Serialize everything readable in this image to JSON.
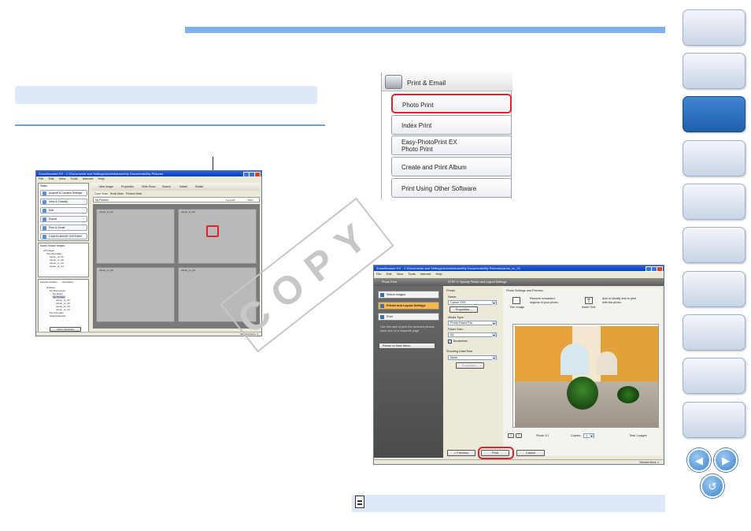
{
  "zoombrowser": {
    "title": "ZoomBrowser EX - C:\\Documents and Settings\\Administrator\\My Documents\\My Pictures",
    "menu": [
      "File",
      "Edit",
      "View",
      "Tools",
      "Internet",
      "Help"
    ],
    "tasks_label": "Tasks",
    "tasks": [
      "Acquire & Camera Settings",
      "View & Classify",
      "Edit",
      "Export",
      "Print & Email",
      "CANON iMAGE GATEWAY"
    ],
    "saved_search_label": "Saved Search Images",
    "saved_search_items": [
      "All Images",
      "Shooting Date",
      "canon_xx_01",
      "canon_xx_02",
      "canon_xx_03",
      "canon_xx_04"
    ],
    "folders_tabs": [
      "Favorite Folders",
      "All Folders"
    ],
    "folder_tree": [
      "Desktop",
      "My Documents",
      "My Music",
      "My Pictures",
      "canon_xx_01",
      "canon_xx_02",
      "canon_xx_03",
      "canon_xx_04",
      "My Computer",
      "Search Results"
    ],
    "add_favorites": "Add to Favorites",
    "toolbar": [
      "New Image",
      "Properties",
      "Slide Show",
      "Search",
      "Delete",
      "Rotate"
    ],
    "view_tabs": [
      "Zoom Mode",
      "Scroll Mode",
      "Preview Mode"
    ],
    "location": "My Pictures",
    "zoom_value": "Level 00",
    "filter_label": "Filter",
    "folder_names": [
      "canon_xx_01",
      "canon_xx_02",
      "canon_xx_03",
      "canon_xx_04"
    ],
    "status": "Selected Items: 1"
  },
  "print_email_menu": {
    "header": "Print & Email",
    "items": [
      {
        "label": "Photo Print",
        "highlight": true
      },
      {
        "label": "Index Print",
        "highlight": false
      },
      {
        "label": "Easy-PhotoPrint EX\nPhoto Print",
        "highlight": false
      },
      {
        "label": "Create and Print Album",
        "highlight": false
      },
      {
        "label": "Print Using Other Software",
        "highlight": false
      }
    ]
  },
  "photo_print": {
    "title": "ZoomBrowser EX - C:\\Documents and Settings\\Administrator\\My Documents\\My Pictures\\canon_xx_01",
    "menu": [
      "File",
      "Edit",
      "View",
      "Tools",
      "Internet",
      "Help"
    ],
    "panel_title": "Photo Print",
    "step_heading": "STEP 2: Specify Printer and Layout Settings",
    "steps": [
      "Select Images",
      "Printer and Layout Settings",
      "Print"
    ],
    "help_text": "Use this task to print the selected photos, each one on a separate page.",
    "return_label": "Return to Main Menu",
    "printer_section": "Printer",
    "name_label": "Name:",
    "printer_name": "Canon XXX",
    "properties_button": "Properties...",
    "media_type_label": "Media Type:",
    "media_type": "Photo Paper Pro",
    "paper_size_label": "Paper Size:",
    "paper_size": "A4",
    "borderless_label": "Borderless",
    "shooting_date_label": "Shooting Date/Time",
    "shooting_date_value": "None",
    "properties_button_2": "Properties...",
    "preview_section": "Photo Settings and Preview",
    "trim_label": "Trim Image",
    "trim_desc": "Remove unwanted regions of your photo.",
    "insert_text_label": "Insert Text",
    "insert_text_desc": "Add or Modify text to print with the photo.",
    "photo_counter": "Photo 1/1",
    "copies_label": "Copies:",
    "copies_value": "1",
    "total_pages": "Total 1 pages",
    "previous_button": "< Previous",
    "print_button": "Print",
    "cancel_button": "Cancel",
    "status": "Selected Items: 1"
  },
  "watermark_text": "COPY",
  "colors": {
    "accent": "#7fb2ec",
    "highlight_red": "#e0222a",
    "active_tab": "#2d6ec0",
    "active_step": "#f6b949"
  }
}
